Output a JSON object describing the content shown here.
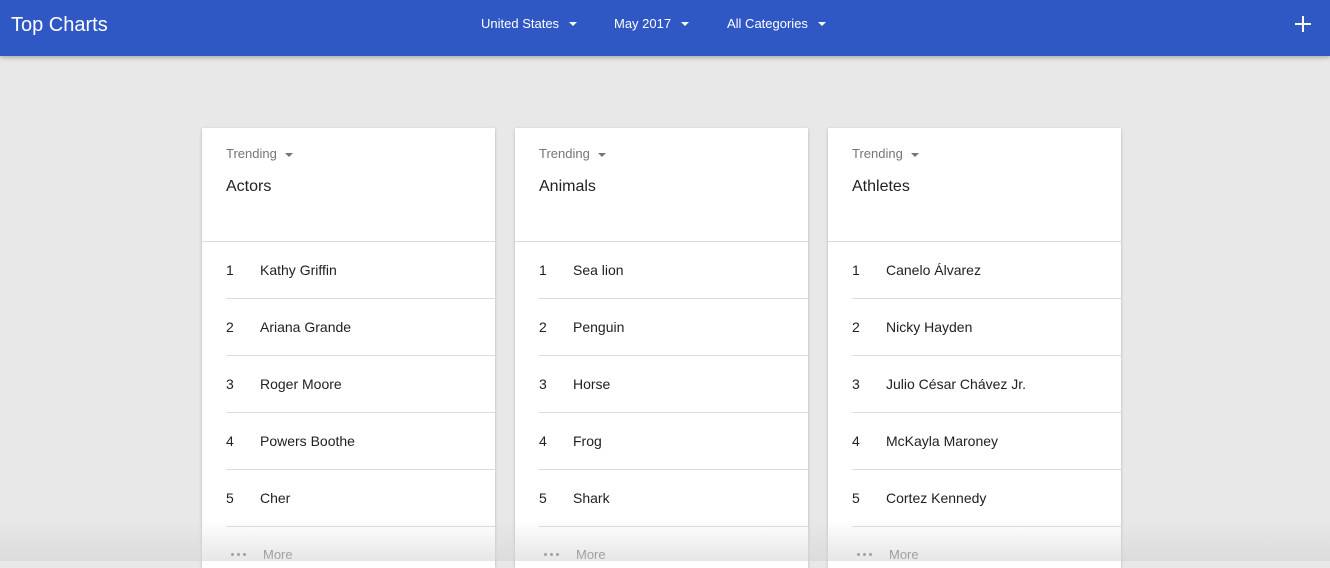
{
  "header": {
    "title": "Top Charts",
    "filters": [
      {
        "label": "United States"
      },
      {
        "label": "May 2017"
      },
      {
        "label": "All Categories"
      }
    ]
  },
  "cards": [
    {
      "dropdown": "Trending",
      "title": "Actors",
      "items": [
        {
          "rank": "1",
          "name": "Kathy Griffin"
        },
        {
          "rank": "2",
          "name": "Ariana Grande"
        },
        {
          "rank": "3",
          "name": "Roger Moore"
        },
        {
          "rank": "4",
          "name": "Powers Boothe"
        },
        {
          "rank": "5",
          "name": "Cher"
        }
      ],
      "more_label": "More"
    },
    {
      "dropdown": "Trending",
      "title": "Animals",
      "items": [
        {
          "rank": "1",
          "name": "Sea lion"
        },
        {
          "rank": "2",
          "name": "Penguin"
        },
        {
          "rank": "3",
          "name": "Horse"
        },
        {
          "rank": "4",
          "name": "Frog"
        },
        {
          "rank": "5",
          "name": "Shark"
        }
      ],
      "more_label": "More"
    },
    {
      "dropdown": "Trending",
      "title": "Athletes",
      "items": [
        {
          "rank": "1",
          "name": "Canelo Álvarez"
        },
        {
          "rank": "2",
          "name": "Nicky Hayden"
        },
        {
          "rank": "3",
          "name": "Julio César Chávez Jr."
        },
        {
          "rank": "4",
          "name": "McKayla Maroney"
        },
        {
          "rank": "5",
          "name": "Cortez Kennedy"
        }
      ],
      "more_label": "More"
    }
  ],
  "colors": {
    "topbar": "#3058c4",
    "background": "#e8e8e8"
  },
  "icons": {
    "add": "plus-icon",
    "dropdown": "caret-down-icon",
    "more": "more-horiz-icon"
  }
}
